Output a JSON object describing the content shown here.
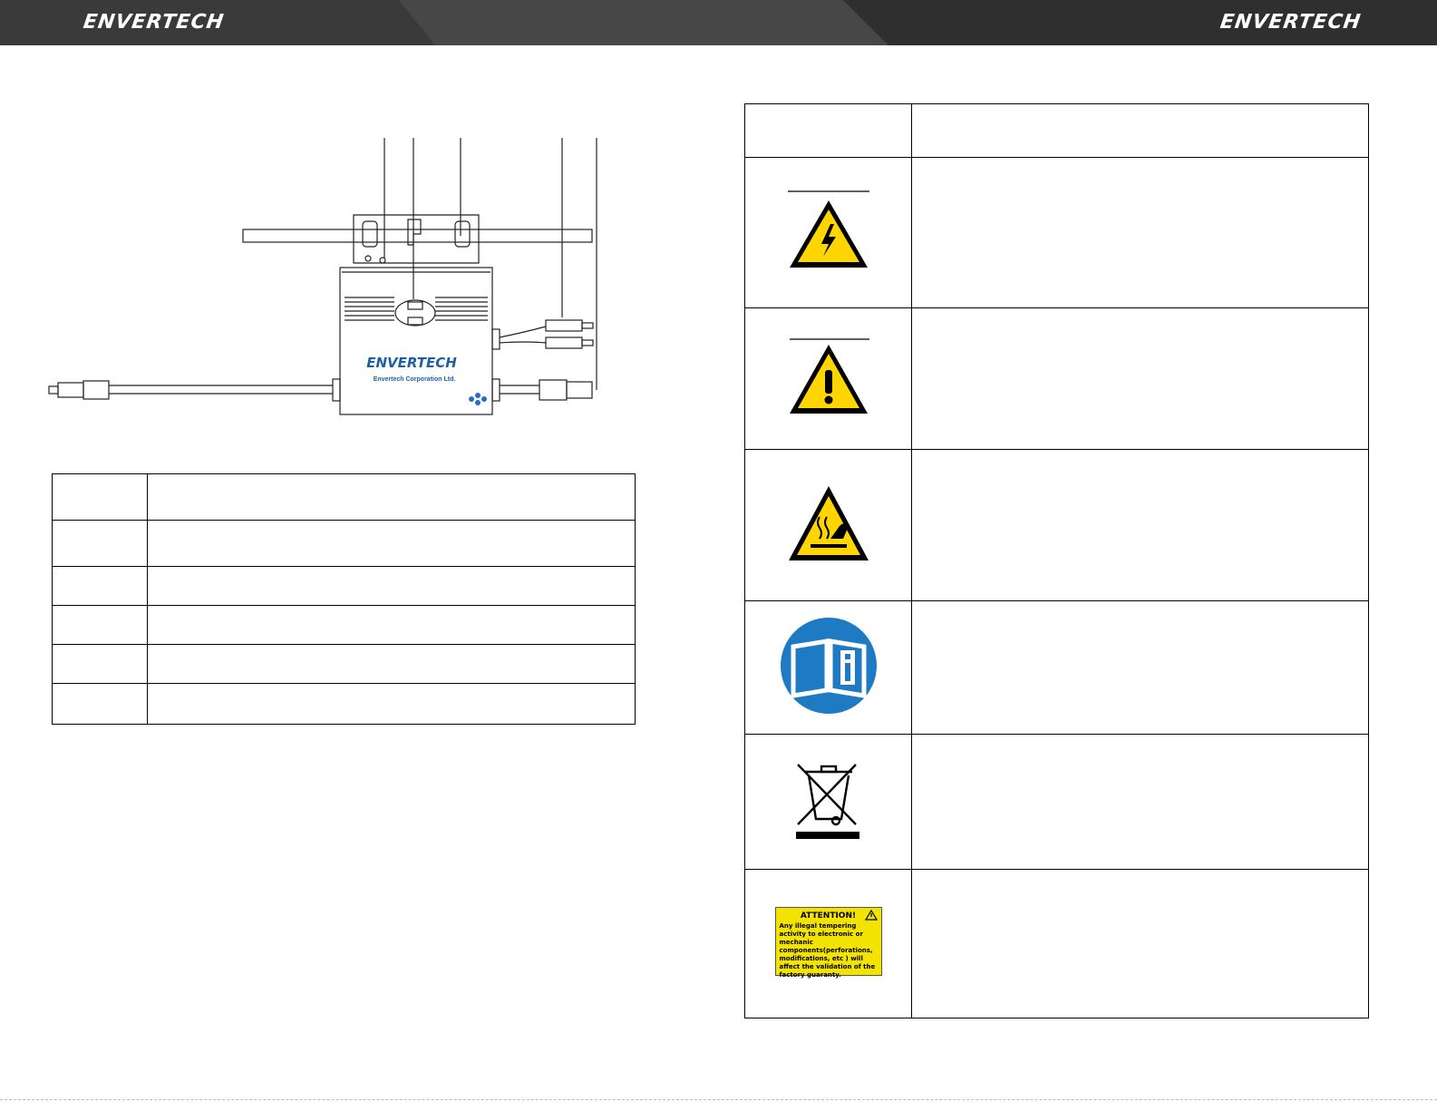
{
  "header": {
    "brand_left": "ENVERTECH",
    "brand_right": "ENVERTECH",
    "colors": {
      "band": "#3a3a3a",
      "stripe": "#555555",
      "text": "#ffffff"
    }
  },
  "drawing": {
    "brand": "ENVERTECH",
    "company": "Envertech Corporation Ltd.",
    "colors": {
      "brand": "#1f5fa8",
      "line": "#222222"
    }
  },
  "part_table": {
    "rows": 6
  },
  "symbols": {
    "header": "",
    "items": [
      {
        "icon": "high-voltage-warning-icon",
        "color": "#ffd500"
      },
      {
        "icon": "general-warning-icon",
        "color": "#ffd500"
      },
      {
        "icon": "hot-surface-warning-icon",
        "color": "#ffd500"
      },
      {
        "icon": "read-manual-icon",
        "color": "#1e7ac2"
      },
      {
        "icon": "weee-crossed-bin-icon",
        "color": "#000000"
      },
      {
        "icon": "attention-label-icon",
        "color": "#f2e300"
      }
    ],
    "attention": {
      "title": "ATTENTION!",
      "text": "Any illegal tempering activity to electronic or mechanic components(perforations, modifications, etc ) will affect the validation of the factory guaranty."
    }
  }
}
